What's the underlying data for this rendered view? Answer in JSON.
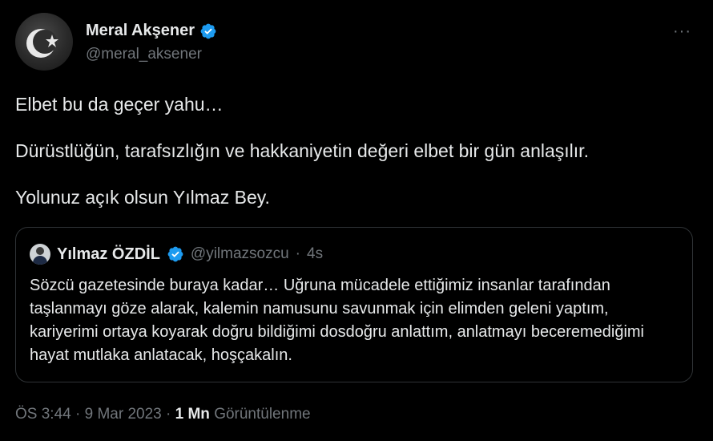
{
  "author": {
    "name": "Meral Akşener",
    "handle": "@meral_aksener"
  },
  "more_label": "···",
  "tweet": {
    "paragraphs": [
      "Elbet bu da geçer yahu…",
      "Dürüstlüğün, tarafsızlığın ve hakkaniyetin değeri elbet bir gün anlaşılır.",
      "Yolunuz açık olsun Yılmaz Bey."
    ]
  },
  "quoted": {
    "name": "Yılmaz ÖZDİL",
    "handle": "@yilmazsozcu",
    "separator": "·",
    "age": "4s",
    "text": "Sözcü gazetesinde buraya kadar… Uğruna mücadele ettiğimiz insanlar tarafından taşlanmayı göze alarak, kalemin namusunu savunmak için elimden geleni yaptım, kariyerimi ortaya koyarak doğru bildiğimi dosdoğru anlattım, anlatmayı beceremediğimi hayat mutlaka anlatacak, hoşçakalın."
  },
  "meta": {
    "time": "ÖS 3:44",
    "sep1": "·",
    "date": "9 Mar 2023",
    "sep2": "·",
    "views_count": "1 Mn",
    "views_label": "Görüntülenme"
  },
  "colors": {
    "background": "#000000",
    "text": "#e7e9ea",
    "secondary": "#71767b",
    "verified": "#1d9bf0",
    "border": "#2f3336"
  }
}
